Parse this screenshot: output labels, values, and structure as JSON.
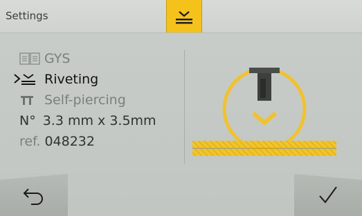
{
  "header": {
    "title": "Settings",
    "active_tab_icon": "riveting-icon",
    "accent_color": "#f4c21b"
  },
  "info": {
    "gys": {
      "icon": "book-icon",
      "label": "GYS"
    },
    "riveting": {
      "icon": "riveting-icon",
      "label": "Riveting",
      "selected": true
    },
    "self_piercing": {
      "icon": "pi-icon",
      "label": "Self-piercing"
    },
    "dimensions": {
      "prefix": "N°",
      "value": "3.3 mm x 3.5mm"
    },
    "reference": {
      "prefix": "ref.",
      "value": "048232"
    }
  },
  "buttons": {
    "back": {
      "icon": "undo-arrow-icon"
    },
    "confirm": {
      "icon": "check-icon"
    }
  }
}
